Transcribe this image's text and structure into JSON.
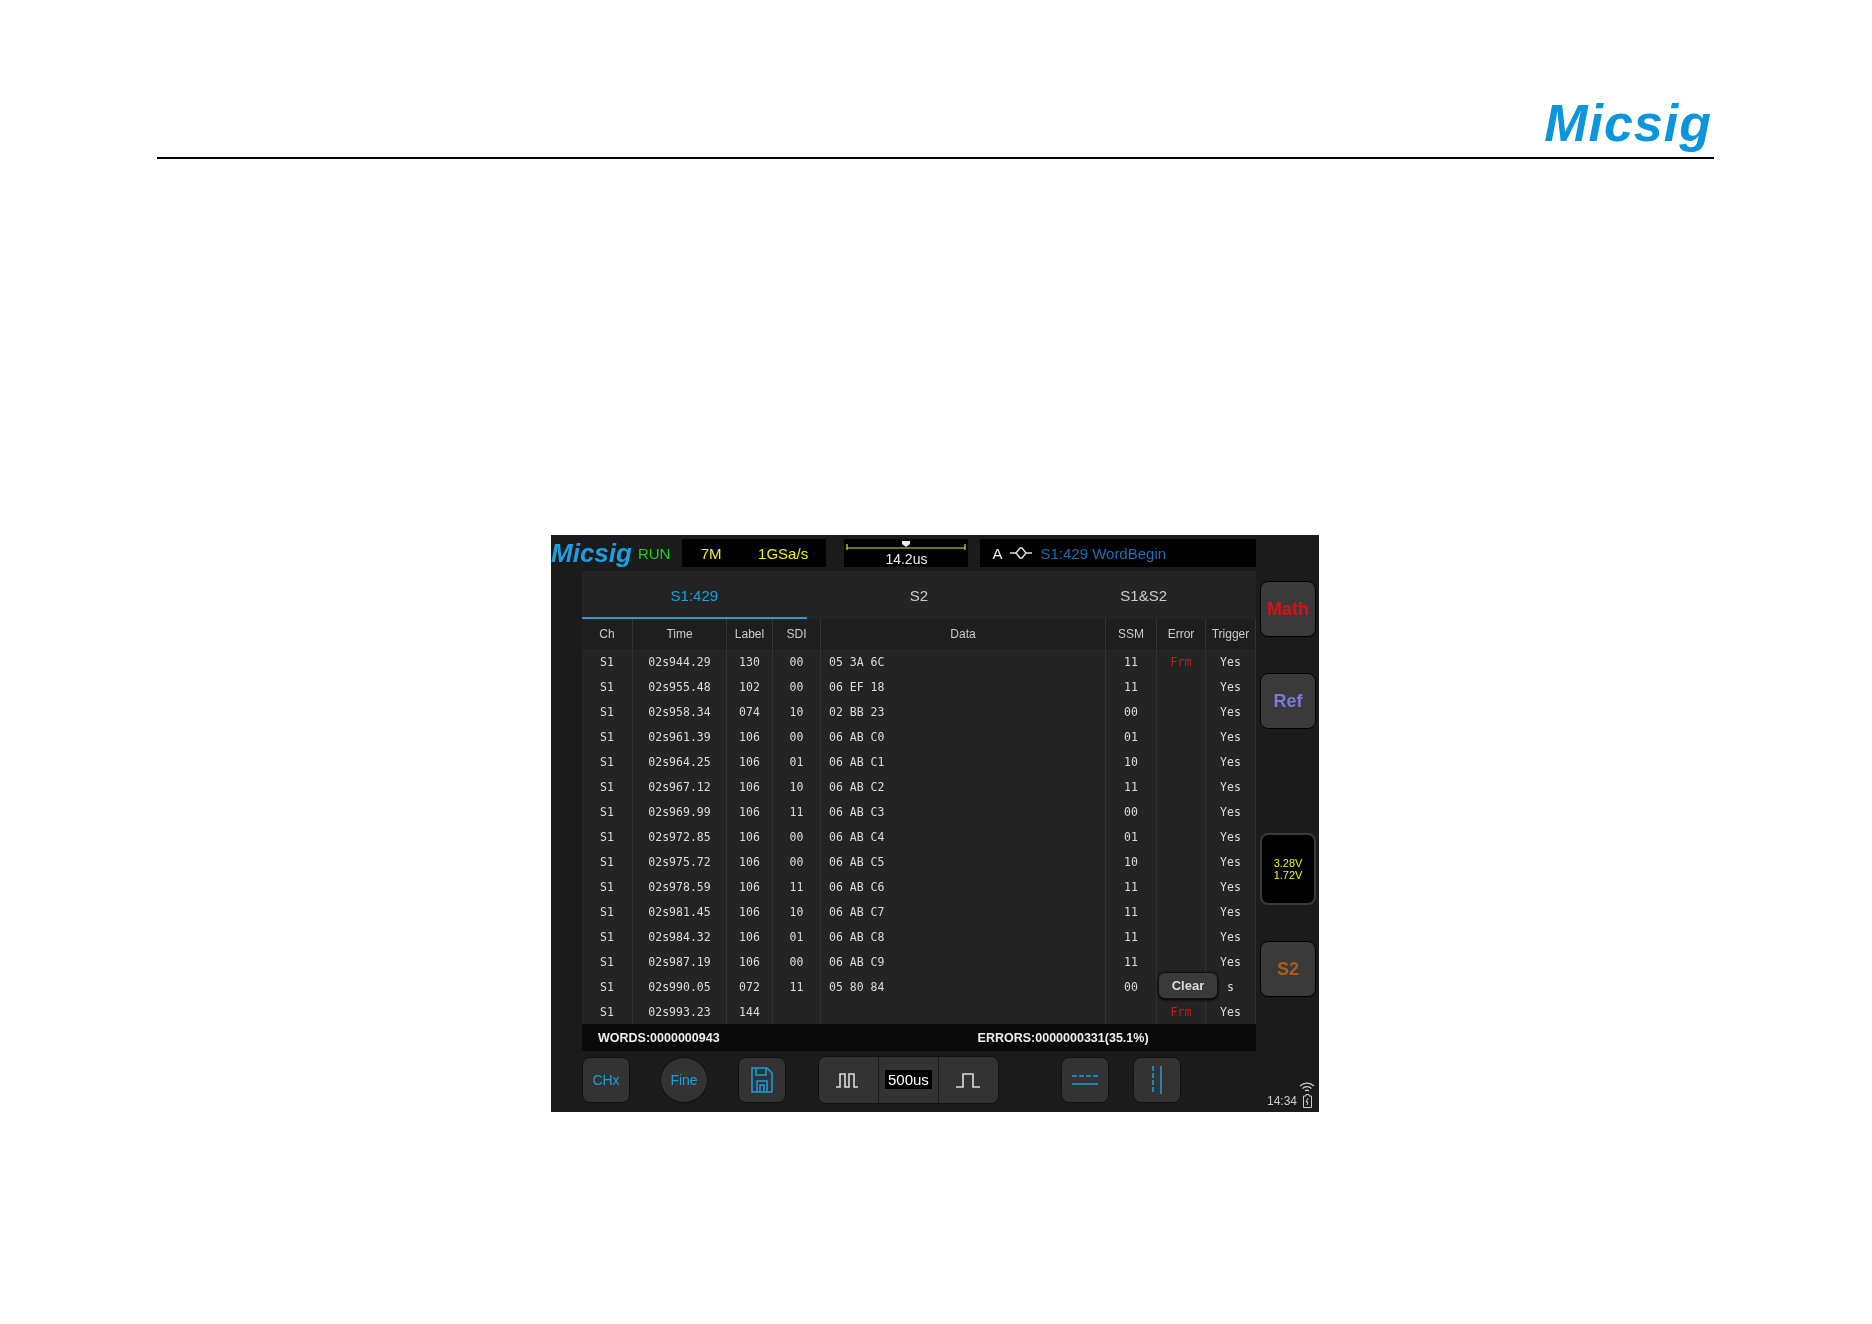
{
  "page_header": {
    "logo": "Micsig"
  },
  "scope": {
    "logo": "Micsig",
    "run_state": "RUN",
    "memory_depth": "7M",
    "sample_rate": "1GSa/s",
    "trigger_time": "14.2us",
    "trigger_source": "A",
    "trigger_info": "S1:429 WordBegin",
    "tabs": [
      {
        "label": "S1:429",
        "selected": true
      },
      {
        "label": "S2",
        "selected": false
      },
      {
        "label": "S1&S2",
        "selected": false
      }
    ],
    "table": {
      "columns": [
        "Ch",
        "Time",
        "Label",
        "SDI",
        "Data",
        "SSM",
        "Error",
        "Trigger"
      ],
      "rows": [
        [
          "S1",
          "02s944.29",
          "130",
          "00",
          "05 3A 6C",
          "11",
          "Frm",
          "Yes"
        ],
        [
          "S1",
          "02s955.48",
          "102",
          "00",
          "06 EF 18",
          "11",
          "",
          "Yes"
        ],
        [
          "S1",
          "02s958.34",
          "074",
          "10",
          "02 BB 23",
          "00",
          "",
          "Yes"
        ],
        [
          "S1",
          "02s961.39",
          "106",
          "00",
          "06 AB C0",
          "01",
          "",
          "Yes"
        ],
        [
          "S1",
          "02s964.25",
          "106",
          "01",
          "06 AB C1",
          "10",
          "",
          "Yes"
        ],
        [
          "S1",
          "02s967.12",
          "106",
          "10",
          "06 AB C2",
          "11",
          "",
          "Yes"
        ],
        [
          "S1",
          "02s969.99",
          "106",
          "11",
          "06 AB C3",
          "00",
          "",
          "Yes"
        ],
        [
          "S1",
          "02s972.85",
          "106",
          "00",
          "06 AB C4",
          "01",
          "",
          "Yes"
        ],
        [
          "S1",
          "02s975.72",
          "106",
          "00",
          "06 AB C5",
          "10",
          "",
          "Yes"
        ],
        [
          "S1",
          "02s978.59",
          "106",
          "11",
          "06 AB C6",
          "11",
          "",
          "Yes"
        ],
        [
          "S1",
          "02s981.45",
          "106",
          "10",
          "06 AB C7",
          "11",
          "",
          "Yes"
        ],
        [
          "S1",
          "02s984.32",
          "106",
          "01",
          "06 AB C8",
          "11",
          "",
          "Yes"
        ],
        [
          "S1",
          "02s987.19",
          "106",
          "00",
          "06 AB C9",
          "11",
          "",
          "Yes"
        ],
        [
          "S1",
          "02s990.05",
          "072",
          "11",
          "05 80 84",
          "00",
          "",
          "s"
        ],
        [
          "S1",
          "02s993.23",
          "144",
          "",
          "",
          "",
          "Frm",
          "Yes"
        ]
      ]
    },
    "clear_button": "Clear",
    "words": "WORDS:0000000943",
    "errors": "ERRORS:0000000331(35.1%)",
    "side_buttons": [
      {
        "label": "Math",
        "kind": "button",
        "color": "#e01010"
      },
      {
        "label": "Ref",
        "kind": "button",
        "color": "#7b7bd8"
      },
      {
        "kind": "meter",
        "values": [
          "3.28V",
          "1.72V"
        ],
        "color": "#f0f020"
      },
      {
        "label": "S2",
        "kind": "button",
        "color": "#b05a18"
      }
    ],
    "toolbar": {
      "chx": "CHx",
      "fine": "Fine",
      "timebase": "500us"
    },
    "clock": "14:34"
  }
}
